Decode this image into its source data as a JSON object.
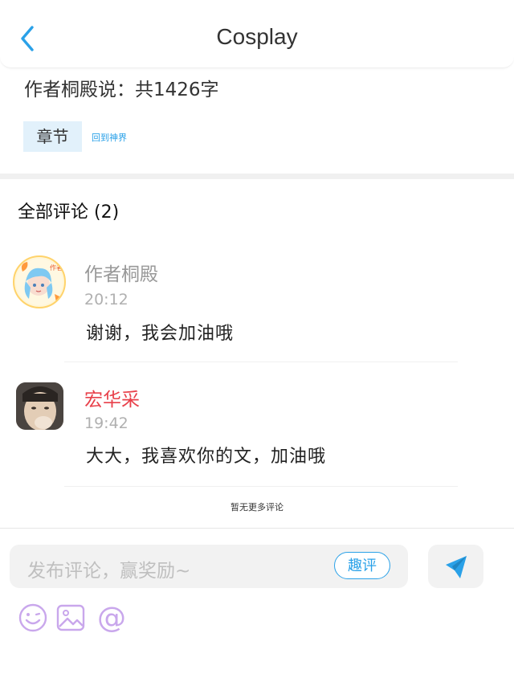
{
  "header": {
    "title": "Cosplay"
  },
  "article": {
    "author_note": "作者桐殿说：共1426字",
    "chapter_label": "章节",
    "back_link": "回到神界"
  },
  "comments_section": {
    "heading": "全部评论 (2)",
    "items": [
      {
        "name": "作者桐殿",
        "time": "20:12",
        "text": "谢谢，我会加油哦",
        "name_color": "#999999",
        "avatar_badge": "作者"
      },
      {
        "name": "宏华采",
        "time": "19:42",
        "text": "大大，我喜欢你的文，加油哦",
        "name_color": "#e8404a"
      }
    ],
    "no_more": "暂无更多评论"
  },
  "composer": {
    "placeholder": "发布评论，赢奖励~",
    "fun_button": "趣评",
    "icons": [
      "smile-icon",
      "image-icon",
      "at-icon",
      "send-icon"
    ]
  },
  "colors": {
    "accent": "#2aa1e8",
    "tool_icon": "#c9a7ec"
  }
}
